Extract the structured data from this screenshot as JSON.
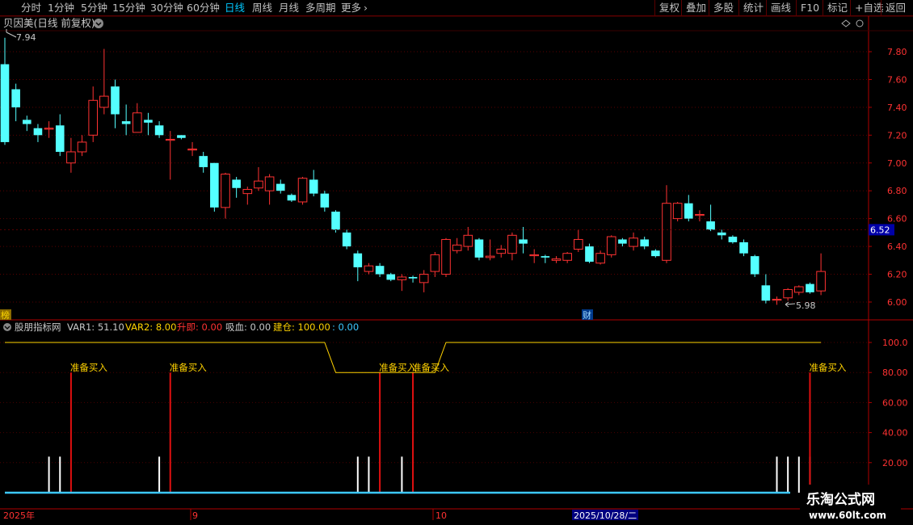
{
  "topbar": {
    "left": [
      "分时",
      "1分钟",
      "5分钟",
      "15分钟",
      "30分钟",
      "60分钟",
      "日线",
      "周线",
      "月线",
      "多周期",
      "更多"
    ],
    "active": "日线",
    "right": [
      "复权",
      "叠加",
      "多股",
      "统计",
      "画线",
      "F10",
      "标记",
      "+自选",
      "返回"
    ]
  },
  "main": {
    "title": "贝因美(日线 前复权)",
    "high_label": "7.94",
    "low_label": "5.98",
    "current_price": "6.52",
    "y_ticks": [
      "7.80",
      "7.60",
      "7.40",
      "7.20",
      "7.00",
      "6.80",
      "6.60",
      "6.40",
      "6.20",
      "6.00"
    ],
    "marker_bang": "榜",
    "marker_cai": "财",
    "up_color": "#ff3232",
    "down_color": "#54ffff"
  },
  "indicator": {
    "name": "股朋指标网",
    "var1": "VAR1: 51.10",
    "var2": "VAR2: 8.00",
    "shengji": "升即: 0.00",
    "xuexue": "吸血: 0.00",
    "jiancang": "建仓: 100.00",
    "extra": ": 0.00",
    "y_ticks": [
      "100.0",
      "80.00",
      "60.00",
      "40.00",
      "20.00"
    ],
    "signal_text": "准备买入"
  },
  "timeline": {
    "year": "2025年",
    "m9": "9",
    "m10": "10",
    "cursor_date": "2025/10/28/二"
  },
  "watermark": {
    "title": "乐淘公式网",
    "url": "www.60lt.com"
  },
  "chart_data": {
    "type": "candlestick",
    "candles": [
      {
        "o": 7.71,
        "c": 7.15,
        "h": 7.9,
        "l": 7.13
      },
      {
        "o": 7.53,
        "c": 7.4,
        "h": 7.57,
        "l": 7.3
      },
      {
        "o": 7.31,
        "c": 7.28,
        "h": 7.34,
        "l": 7.23
      },
      {
        "o": 7.25,
        "c": 7.2,
        "h": 7.28,
        "l": 7.15
      },
      {
        "o": 7.25,
        "c": 7.25,
        "h": 7.3,
        "l": 7.18
      },
      {
        "o": 7.27,
        "c": 7.08,
        "h": 7.35,
        "l": 7.05
      },
      {
        "o": 7.0,
        "c": 7.08,
        "h": 7.18,
        "l": 6.93
      },
      {
        "o": 7.08,
        "c": 7.15,
        "h": 7.2,
        "l": 7.05
      },
      {
        "o": 7.2,
        "c": 7.45,
        "h": 7.55,
        "l": 7.15
      },
      {
        "o": 7.4,
        "c": 7.48,
        "h": 7.82,
        "l": 7.35
      },
      {
        "o": 7.55,
        "c": 7.35,
        "h": 7.6,
        "l": 7.25
      },
      {
        "o": 7.3,
        "c": 7.28,
        "h": 7.42,
        "l": 7.2
      },
      {
        "o": 7.22,
        "c": 7.36,
        "h": 7.43,
        "l": 7.22
      },
      {
        "o": 7.31,
        "c": 7.29,
        "h": 7.36,
        "l": 7.2
      },
      {
        "o": 7.27,
        "c": 7.2,
        "h": 7.3,
        "l": 7.18
      },
      {
        "o": 7.17,
        "c": 7.17,
        "h": 7.23,
        "l": 6.88
      },
      {
        "o": 7.2,
        "c": 7.18,
        "h": 7.2,
        "l": 7.17
      },
      {
        "o": 7.1,
        "c": 7.1,
        "h": 7.15,
        "l": 7.05
      },
      {
        "o": 7.05,
        "c": 6.97,
        "h": 7.08,
        "l": 6.93
      },
      {
        "o": 7.0,
        "c": 6.68,
        "h": 7.0,
        "l": 6.65
      },
      {
        "o": 6.68,
        "c": 6.92,
        "h": 6.93,
        "l": 6.6
      },
      {
        "o": 6.88,
        "c": 6.82,
        "h": 6.9,
        "l": 6.75
      },
      {
        "o": 6.78,
        "c": 6.81,
        "h": 6.83,
        "l": 6.7
      },
      {
        "o": 6.82,
        "c": 6.87,
        "h": 6.97,
        "l": 6.8
      },
      {
        "o": 6.8,
        "c": 6.9,
        "h": 6.92,
        "l": 6.7
      },
      {
        "o": 6.85,
        "c": 6.8,
        "h": 6.88,
        "l": 6.78
      },
      {
        "o": 6.77,
        "c": 6.73,
        "h": 6.78,
        "l": 6.72
      },
      {
        "o": 6.72,
        "c": 6.89,
        "h": 6.9,
        "l": 6.7
      },
      {
        "o": 6.88,
        "c": 6.78,
        "h": 6.95,
        "l": 6.76
      },
      {
        "o": 6.78,
        "c": 6.68,
        "h": 6.8,
        "l": 6.65
      },
      {
        "o": 6.65,
        "c": 6.52,
        "h": 6.66,
        "l": 6.5
      },
      {
        "o": 6.5,
        "c": 6.4,
        "h": 6.52,
        "l": 6.38
      },
      {
        "o": 6.35,
        "c": 6.25,
        "h": 6.37,
        "l": 6.15
      },
      {
        "o": 6.22,
        "c": 6.26,
        "h": 6.28,
        "l": 6.2
      },
      {
        "o": 6.26,
        "c": 6.2,
        "h": 6.28,
        "l": 6.18
      },
      {
        "o": 6.2,
        "c": 6.16,
        "h": 6.21,
        "l": 6.15
      },
      {
        "o": 6.16,
        "c": 6.18,
        "h": 6.2,
        "l": 6.08
      },
      {
        "o": 6.18,
        "c": 6.17,
        "h": 6.19,
        "l": 6.14
      },
      {
        "o": 6.14,
        "c": 6.2,
        "h": 6.23,
        "l": 6.07
      },
      {
        "o": 6.22,
        "c": 6.34,
        "h": 6.36,
        "l": 6.18
      },
      {
        "o": 6.2,
        "c": 6.45,
        "h": 6.46,
        "l": 6.18
      },
      {
        "o": 6.37,
        "c": 6.41,
        "h": 6.46,
        "l": 6.35
      },
      {
        "o": 6.4,
        "c": 6.48,
        "h": 6.54,
        "l": 6.37
      },
      {
        "o": 6.45,
        "c": 6.32,
        "h": 6.46,
        "l": 6.3
      },
      {
        "o": 6.32,
        "c": 6.33,
        "h": 6.45,
        "l": 6.3
      },
      {
        "o": 6.35,
        "c": 6.38,
        "h": 6.41,
        "l": 6.32
      },
      {
        "o": 6.35,
        "c": 6.48,
        "h": 6.5,
        "l": 6.3
      },
      {
        "o": 6.45,
        "c": 6.42,
        "h": 6.54,
        "l": 6.35
      },
      {
        "o": 6.34,
        "c": 6.34,
        "h": 6.38,
        "l": 6.28
      },
      {
        "o": 6.33,
        "c": 6.32,
        "h": 6.34,
        "l": 6.28
      },
      {
        "o": 6.3,
        "c": 6.31,
        "h": 6.33,
        "l": 6.28
      },
      {
        "o": 6.3,
        "c": 6.35,
        "h": 6.36,
        "l": 6.28
      },
      {
        "o": 6.38,
        "c": 6.45,
        "h": 6.52,
        "l": 6.36
      },
      {
        "o": 6.4,
        "c": 6.29,
        "h": 6.42,
        "l": 6.28
      },
      {
        "o": 6.28,
        "c": 6.35,
        "h": 6.37,
        "l": 6.27
      },
      {
        "o": 6.34,
        "c": 6.47,
        "h": 6.48,
        "l": 6.32
      },
      {
        "o": 6.45,
        "c": 6.42,
        "h": 6.46,
        "l": 6.4
      },
      {
        "o": 6.4,
        "c": 6.46,
        "h": 6.5,
        "l": 6.37
      },
      {
        "o": 6.45,
        "c": 6.4,
        "h": 6.47,
        "l": 6.38
      },
      {
        "o": 6.37,
        "c": 6.33,
        "h": 6.38,
        "l": 6.32
      },
      {
        "o": 6.3,
        "c": 6.71,
        "h": 6.84,
        "l": 6.28
      },
      {
        "o": 6.6,
        "c": 6.71,
        "h": 6.72,
        "l": 6.58
      },
      {
        "o": 6.71,
        "c": 6.6,
        "h": 6.77,
        "l": 6.58
      },
      {
        "o": 6.63,
        "c": 6.63,
        "h": 6.66,
        "l": 6.58
      },
      {
        "o": 6.58,
        "c": 6.52,
        "h": 6.7,
        "l": 6.51
      },
      {
        "o": 6.5,
        "c": 6.48,
        "h": 6.52,
        "l": 6.45
      },
      {
        "o": 6.47,
        "c": 6.43,
        "h": 6.48,
        "l": 6.42
      },
      {
        "o": 6.43,
        "c": 6.35,
        "h": 6.45,
        "l": 6.33
      },
      {
        "o": 6.33,
        "c": 6.2,
        "h": 6.34,
        "l": 6.18
      },
      {
        "o": 6.12,
        "c": 6.01,
        "h": 6.2,
        "l": 5.99
      },
      {
        "o": 6.02,
        "c": 6.02,
        "h": 6.04,
        "l": 5.98
      },
      {
        "o": 6.03,
        "c": 6.09,
        "h": 6.1,
        "l": 6.01
      },
      {
        "o": 6.07,
        "c": 6.11,
        "h": 6.12,
        "l": 6.05
      },
      {
        "o": 6.13,
        "c": 6.07,
        "h": 6.14,
        "l": 6.06
      },
      {
        "o": 6.08,
        "c": 6.22,
        "h": 6.35,
        "l": 6.05
      }
    ],
    "jiancang_line": [
      {
        "i": 0,
        "v": 100
      },
      {
        "i": 29,
        "v": 100
      },
      {
        "i": 30,
        "v": 80
      },
      {
        "i": 39,
        "v": 80
      },
      {
        "i": 40,
        "v": 100
      },
      {
        "i": 74,
        "v": 100
      }
    ],
    "signals": [
      6,
      15,
      34,
      37,
      73
    ],
    "white_bars": [
      4,
      5,
      14,
      32,
      33,
      36,
      70,
      71,
      72,
      73
    ],
    "indicator_range": [
      0,
      100
    ]
  }
}
